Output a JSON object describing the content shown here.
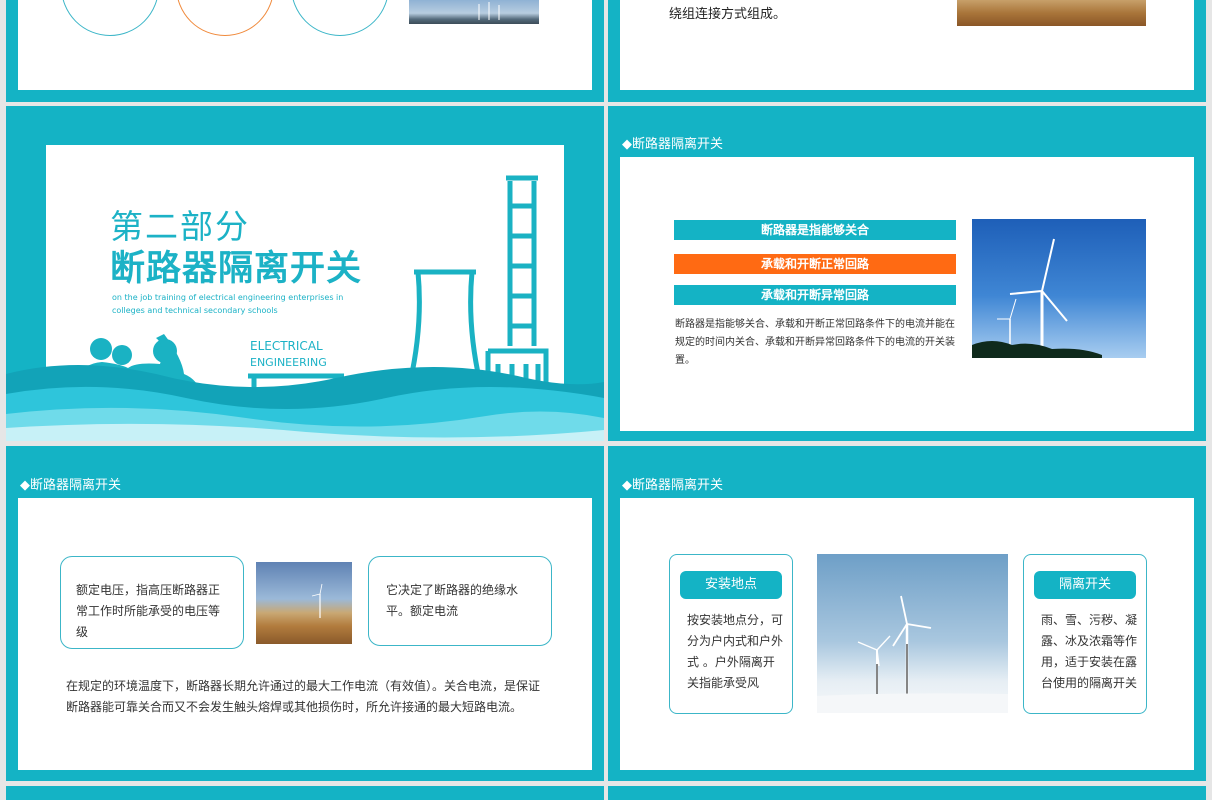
{
  "slide_tl": {},
  "slide_tr": {
    "text": "绕组连接方式组成。"
  },
  "cover": {
    "part": "第二部分",
    "title": "断路器隔离开关",
    "subtitle_line1": "on the job training of electrical engineering enterprises in",
    "subtitle_line2": "colleges and technical secondary schools",
    "label_line1": "ELECTRICAL",
    "label_line2": "ENGINEERING"
  },
  "slide4": {
    "title": "◆断路器隔离开关",
    "bars": [
      "断路器是指能够关合",
      "承载和开断正常回路",
      "承载和开断异常回路"
    ],
    "body": "断路器是指能够关合、承载和开断正常回路条件下的电流并能在规定的时间内关合、承载和开断异常回路条件下的电流的开关装置。"
  },
  "slide5": {
    "title": "◆断路器隔离开关",
    "left_box": "额定电压，指高压断路器正常工作时所能承受的电压等级",
    "right_box": "它决定了断路器的绝缘水平。额定电流",
    "body": "在规定的环境温度下，断路器长期允许通过的最大工作电流（有效值）。关合电流，是保证断路器能可靠关合而又不会发生触头熔焊或其他损伤时，所允许接通的最大短路电流。"
  },
  "slide6": {
    "title": "◆断路器隔离开关",
    "left_tag": "安装地点",
    "left_text": "按安装地点分，可分为户内式和户外式 。户外隔离开关指能承受风",
    "right_tag": "隔离开关",
    "right_text": "雨、雪、污秽、凝露、冰及浓霜等作用，适于安装在露台使用的隔离开关"
  },
  "colors": {
    "accent": "#14b3c5",
    "orange": "#ff6a13",
    "title_teal": "#1cb2c6"
  }
}
